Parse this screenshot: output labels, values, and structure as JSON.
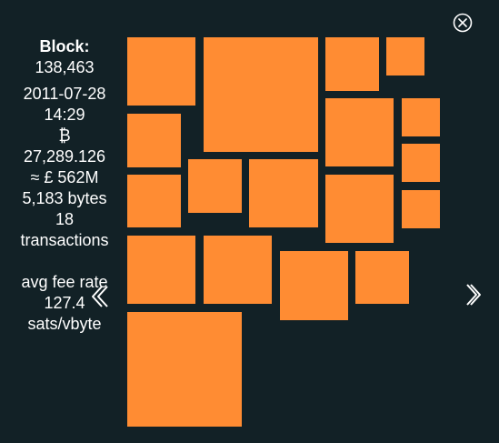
{
  "block": {
    "label": "Block:",
    "height": "138,463",
    "date": "2011-07-28",
    "time": "14:29",
    "btc_symbol": "₿",
    "amount": "27,289.126",
    "fiat": "≈ £ 562M",
    "size": "5,183 bytes",
    "tx_count": "18",
    "tx_label": "transactions",
    "fee_label": "avg fee rate",
    "fee_value": "127.4",
    "fee_unit": "sats/vbyte"
  },
  "controls": {
    "close_icon": "close-circle-icon",
    "prev_icon": "double-chevron-left-icon",
    "next_icon": "chevron-right-icon"
  },
  "colors": {
    "background": "#122126",
    "transaction_fill": "#FF8C33",
    "text": "#ffffff"
  }
}
